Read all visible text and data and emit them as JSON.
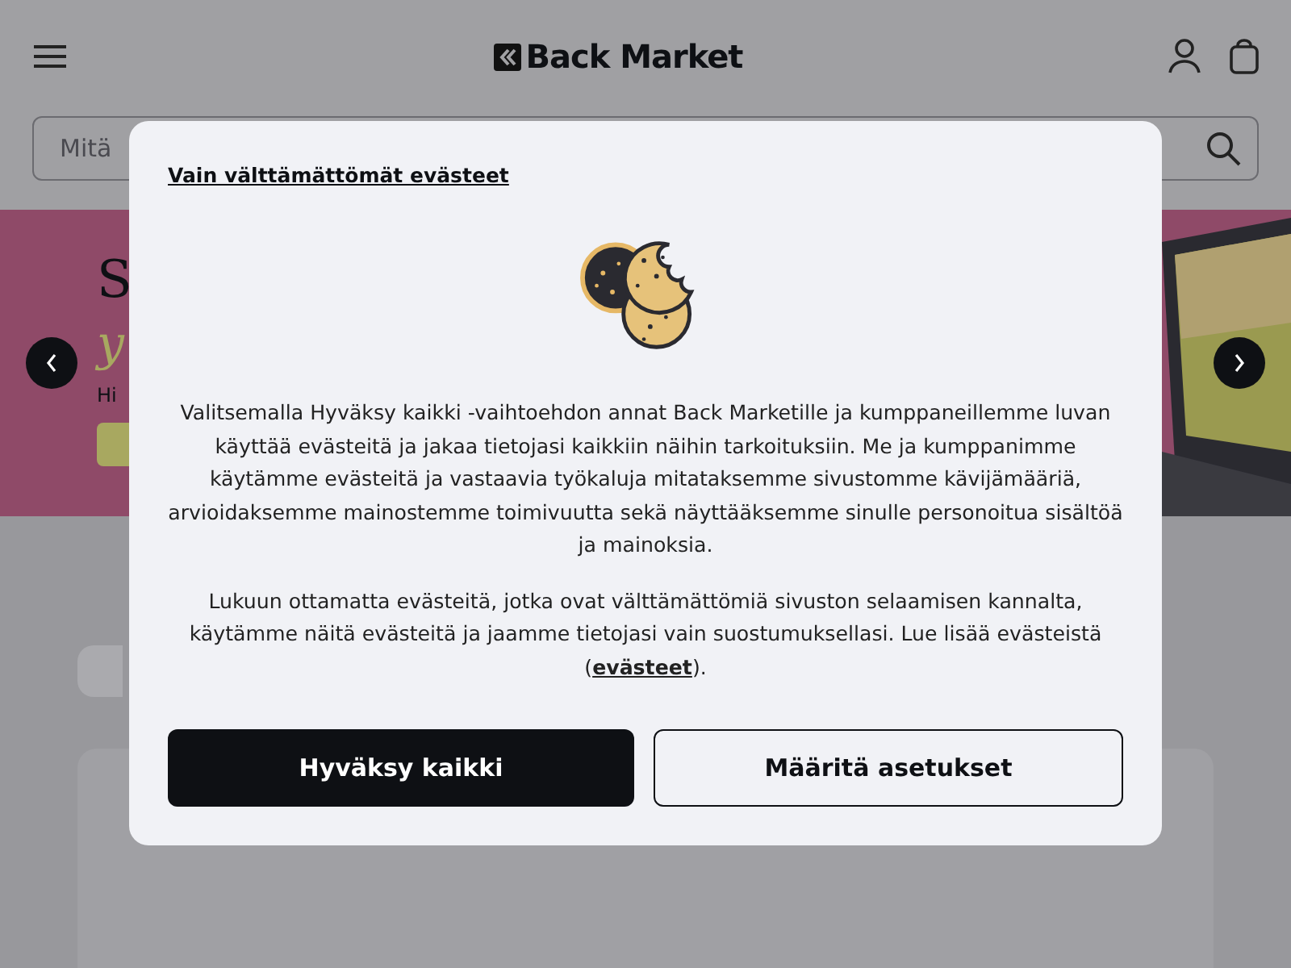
{
  "header": {
    "logo": "Back Market"
  },
  "search": {
    "placeholder": "Mitä"
  },
  "banner": {
    "headline": "S",
    "subline": "y",
    "caption": "Hi"
  },
  "cookie_dialog": {
    "essential_link": "Vain välttämättömät evästeet",
    "paragraphs": [
      "Valitsemalla Hyväksy kaikki -vaihtoehdon annat Back Marketille ja kumppaneillemme luvan käyttää evästeitä ja jakaa tietojasi kaikkiin näihin tarkoituksiin. Me ja kumppanimme käytämme evästeitä ja vastaavia työkaluja mitataksemme sivustomme kävijämääriä, arvioidaksemme mainostemme toimivuutta sekä näyttääksemme sinulle personoitua sisältöä ja mainoksia.",
      "Lukuun ottamatta evästeitä, jotka ovat välttämättömiä sivuston selaamisen kannalta, käytämme näitä evästeitä ja jaamme tietojasi vain suostumuksellasi. Lue lisää evästeistä (**evästeet**)."
    ],
    "buttons": [
      {
        "label": "Hyväksy kaikki",
        "kind": "primary"
      },
      {
        "label": "Määritä asetukset",
        "kind": "secondary"
      }
    ]
  }
}
